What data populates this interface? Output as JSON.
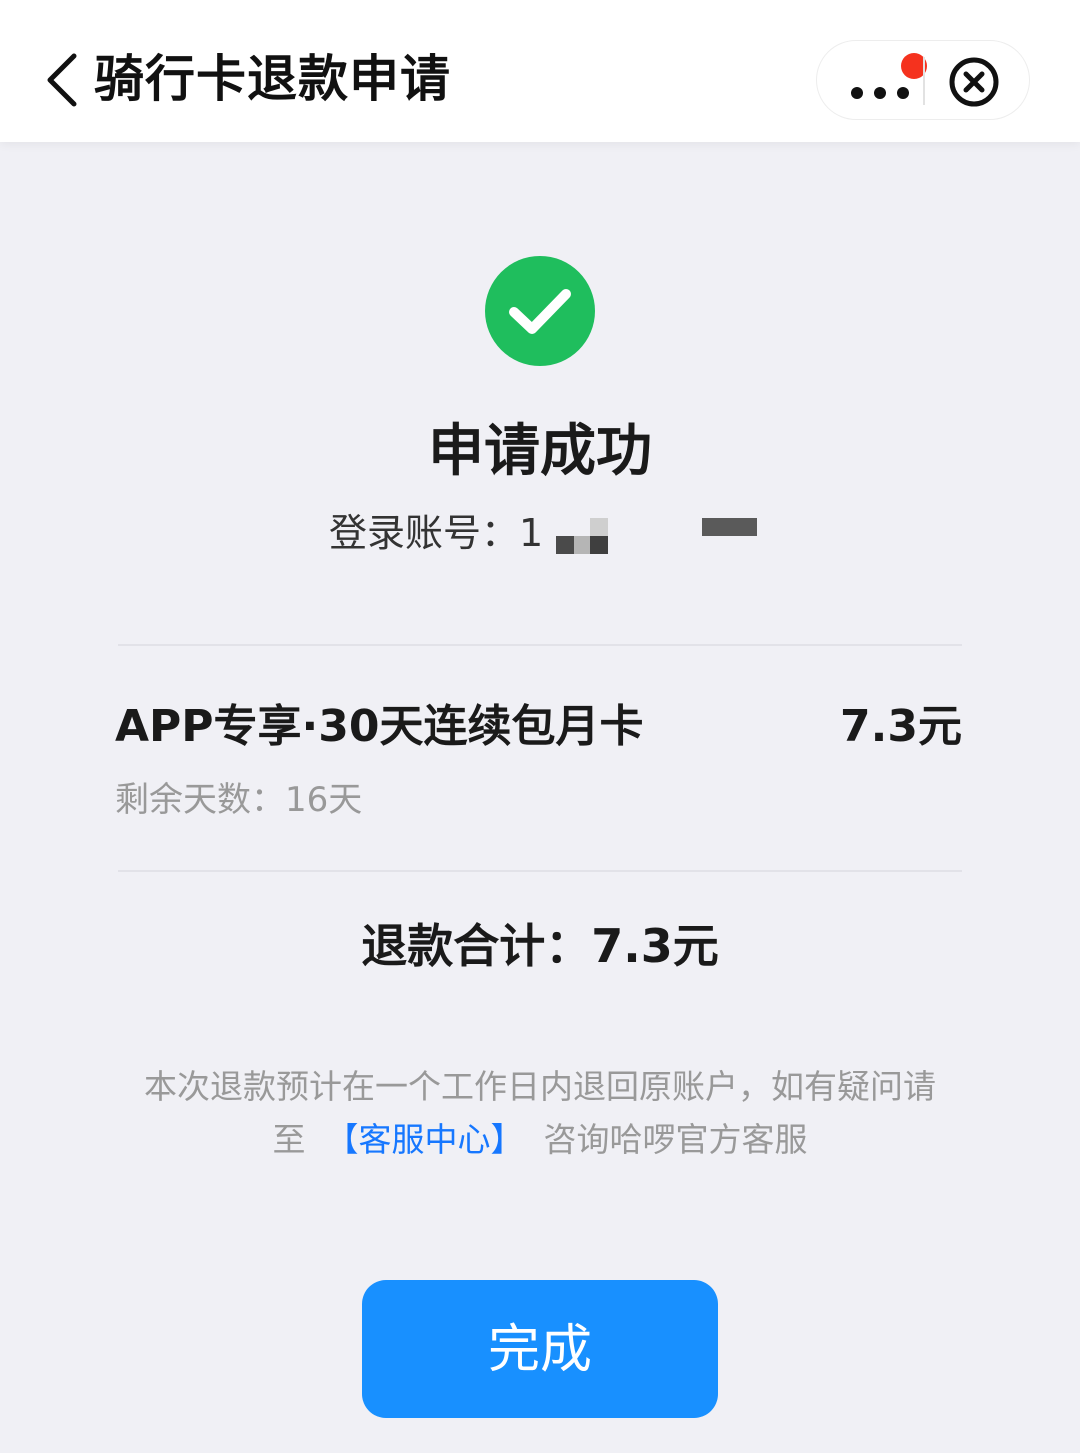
{
  "header": {
    "title": "骑行卡退款申请",
    "back_icon": "chevron-left-icon",
    "more_icon": "more-horizontal-icon",
    "close_icon": "close-circle-icon",
    "notification_dot_color": "#f5321e"
  },
  "result": {
    "icon": "check-circle-icon",
    "icon_color": "#1fbe5d",
    "title": "申请成功",
    "account_label": "登录账号：",
    "account_visible": "1"
  },
  "order": {
    "product_name": "APP专享·30天连续包月卡",
    "price": "7.3元",
    "remaining_days": "剩余天数：16天"
  },
  "total": {
    "text": "退款合计：7.3元"
  },
  "notice": {
    "part1": "本次退款预计在一个工作日内退回原账户，如有疑问请至",
    "link": "【客服中心】",
    "part2": "咨询哈啰官方客服",
    "link_color": "#1677ff"
  },
  "actions": {
    "done_label": "完成",
    "done_color": "#1890ff"
  }
}
